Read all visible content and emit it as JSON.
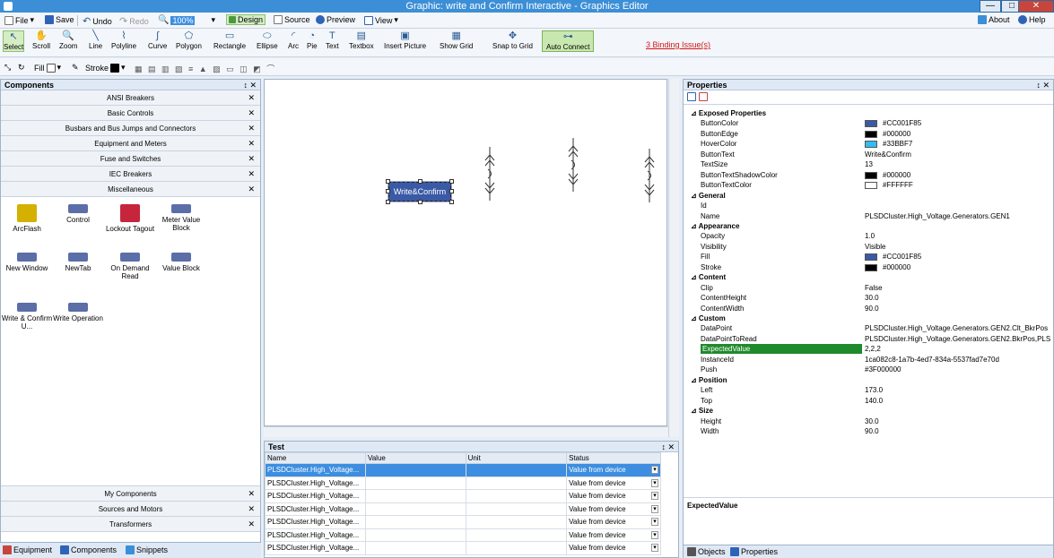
{
  "window": {
    "title": "Graphic: write and Confirm Interactive - Graphics Editor",
    "minimize": "—",
    "maximize": "□",
    "close": "✕"
  },
  "menubar": {
    "file": "File",
    "save": "Save",
    "undo": "Undo",
    "redo": "Redo",
    "zoom": "100%",
    "design": "Design",
    "source": "Source",
    "preview": "Preview",
    "view": "View",
    "about": "About",
    "help": "Help"
  },
  "toolbar": {
    "tools": [
      "Select",
      "Scroll",
      "Zoom",
      "Line",
      "Polyline",
      "Curve",
      "Polygon",
      "Rectangle",
      "Ellipse",
      "Arc",
      "Pie",
      "Text",
      "Textbox",
      "Insert Picture",
      "Show Grid",
      "Snap to Grid"
    ],
    "auto_connect": "Auto Connect",
    "binding_issues": "3 Binding Issue(s)"
  },
  "toolbar2": {
    "fill": "Fill",
    "stroke": "Stroke"
  },
  "components": {
    "header": "Components",
    "pin": "↕ ✕",
    "categories": [
      "ANSI Breakers",
      "Basic Controls",
      "Busbars and Bus Jumps and Connectors",
      "Equipment and Meters",
      "Fuse and Switches",
      "IEC Breakers",
      "Miscellaneous"
    ],
    "items": [
      {
        "label": "ArcFlash"
      },
      {
        "label": "Control"
      },
      {
        "label": "Lockout Tagout"
      },
      {
        "label": "Meter Value Block"
      },
      {
        "label": "New Window"
      },
      {
        "label": "NewTab"
      },
      {
        "label": "On Demand Read"
      },
      {
        "label": "Value Block"
      },
      {
        "label": "Write & Confirm U..."
      },
      {
        "label": "Write Operation"
      }
    ],
    "bottom_categories": [
      "My Components",
      "Sources and Motors",
      "Transformers"
    ]
  },
  "bottom_tabs": [
    "Equipment",
    "Components",
    "Snippets"
  ],
  "canvas": {
    "button_text": "Write&Confirm"
  },
  "test_panel": {
    "header": "Test",
    "pin": "↕ ✕",
    "columns": [
      "Name",
      "Value",
      "Unit",
      "Status"
    ],
    "rows": [
      {
        "name": "PLSDCluster.High_Voltage...",
        "value": "",
        "unit": "",
        "status": "Value from device"
      },
      {
        "name": "PLSDCluster.High_Voltage...",
        "value": "",
        "unit": "",
        "status": "Value from device"
      },
      {
        "name": "PLSDCluster.High_Voltage...",
        "value": "",
        "unit": "",
        "status": "Value from device"
      },
      {
        "name": "PLSDCluster.High_Voltage...",
        "value": "",
        "unit": "",
        "status": "Value from device"
      },
      {
        "name": "PLSDCluster.High_Voltage...",
        "value": "",
        "unit": "",
        "status": "Value from device"
      },
      {
        "name": "PLSDCluster.High_Voltage...",
        "value": "",
        "unit": "",
        "status": "Value from device"
      },
      {
        "name": "PLSDCluster.High_Voltage...",
        "value": "",
        "unit": "",
        "status": "Value from device"
      }
    ]
  },
  "properties": {
    "header": "Properties",
    "pin": "↕ ✕",
    "rows": [
      {
        "type": "section",
        "name": "Exposed Properties"
      },
      {
        "name": "ButtonColor",
        "value": "#CC001F85",
        "swatch": "#3a5aa6"
      },
      {
        "name": "ButtonEdge",
        "value": "#000000",
        "swatch": "#000000"
      },
      {
        "name": "HoverColor",
        "value": "#33BBF7",
        "swatch": "#33bbf7"
      },
      {
        "name": "ButtonText",
        "value": "Write&Confirm"
      },
      {
        "name": "TextSize",
        "value": "13"
      },
      {
        "name": "ButtonTextShadowColor",
        "value": "#000000",
        "swatch": "#000000"
      },
      {
        "name": "ButtonTextColor",
        "value": "#FFFFFF",
        "swatch": "#ffffff"
      },
      {
        "type": "section",
        "name": "General"
      },
      {
        "name": "Id",
        "value": ""
      },
      {
        "name": "Name",
        "value": "PLSDCluster.High_Voltage.Generators.GEN1"
      },
      {
        "type": "section",
        "name": "Appearance"
      },
      {
        "name": "Opacity",
        "value": "1.0"
      },
      {
        "name": "Visibility",
        "value": "Visible"
      },
      {
        "name": "Fill",
        "value": "#CC001F85",
        "swatch": "#3a5aa6"
      },
      {
        "name": "Stroke",
        "value": "#000000",
        "swatch": "#000000"
      },
      {
        "type": "section",
        "name": "Content"
      },
      {
        "name": "Clip",
        "value": "False"
      },
      {
        "name": "ContentHeight",
        "value": "30.0"
      },
      {
        "name": "ContentWidth",
        "value": "90.0"
      },
      {
        "type": "section",
        "name": "Custom"
      },
      {
        "name": "DataPoint",
        "value": "PLSDCluster.High_Voltage.Generators.GEN2.Clt_BkrPos"
      },
      {
        "name": "DataPointToRead",
        "value": "PLSDCluster.High_Voltage.Generators.GEN2.BkrPos,PLS"
      },
      {
        "name": "ExpectedValue",
        "value": "2,2,2",
        "selected": true
      },
      {
        "name": "InstanceId",
        "value": "1ca082c8-1a7b-4ed7-834a-5537fad7e70d"
      },
      {
        "name": "Push",
        "value": "#3F000000"
      },
      {
        "type": "section",
        "name": "Position"
      },
      {
        "name": "Left",
        "value": "173.0"
      },
      {
        "name": "Top",
        "value": "140.0"
      },
      {
        "type": "section",
        "name": "Size"
      },
      {
        "name": "Height",
        "value": "30.0"
      },
      {
        "name": "Width",
        "value": "90.0"
      }
    ],
    "description_title": "ExpectedValue",
    "tabs": [
      "Objects",
      "Properties"
    ]
  }
}
